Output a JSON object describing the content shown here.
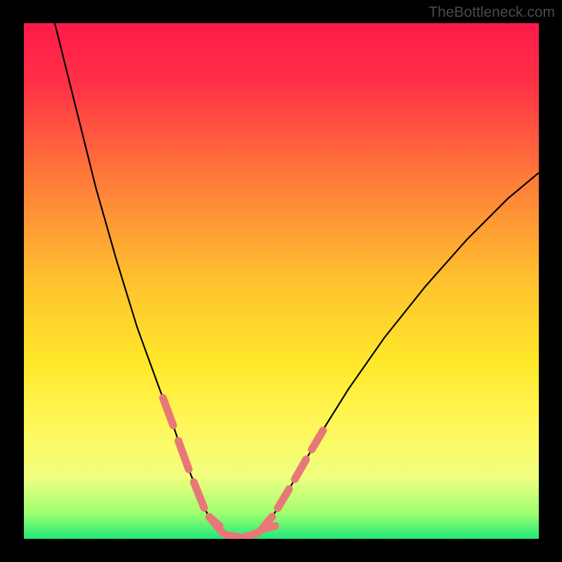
{
  "watermark": "TheBottleneck.com",
  "chart_data": {
    "type": "line",
    "title": "",
    "xlabel": "",
    "ylabel": "",
    "x_range": [
      0,
      100
    ],
    "y_range": [
      0,
      100
    ],
    "background_gradient": {
      "stops": [
        {
          "offset": 0,
          "color": "#ff1a4a"
        },
        {
          "offset": 0.12,
          "color": "#ff3246"
        },
        {
          "offset": 0.3,
          "color": "#ff7a3a"
        },
        {
          "offset": 0.5,
          "color": "#ffc22e"
        },
        {
          "offset": 0.66,
          "color": "#ffe82a"
        },
        {
          "offset": 0.78,
          "color": "#fff85a"
        },
        {
          "offset": 0.88,
          "color": "#f0ff80"
        },
        {
          "offset": 0.95,
          "color": "#a0ff70"
        },
        {
          "offset": 1.0,
          "color": "#20e878"
        }
      ]
    },
    "curve": {
      "description": "V-shaped bottleneck curve",
      "points": [
        {
          "x": 6,
          "y": 100
        },
        {
          "x": 10,
          "y": 84
        },
        {
          "x": 14,
          "y": 68
        },
        {
          "x": 18,
          "y": 54
        },
        {
          "x": 22,
          "y": 41
        },
        {
          "x": 26,
          "y": 30
        },
        {
          "x": 29,
          "y": 22
        },
        {
          "x": 31,
          "y": 16
        },
        {
          "x": 33,
          "y": 11
        },
        {
          "x": 35,
          "y": 6
        },
        {
          "x": 37,
          "y": 2.5
        },
        {
          "x": 39,
          "y": 0.8
        },
        {
          "x": 41,
          "y": 0.3
        },
        {
          "x": 43,
          "y": 0.3
        },
        {
          "x": 45,
          "y": 0.8
        },
        {
          "x": 47,
          "y": 2.5
        },
        {
          "x": 50,
          "y": 7
        },
        {
          "x": 54,
          "y": 14
        },
        {
          "x": 58,
          "y": 21
        },
        {
          "x": 63,
          "y": 29
        },
        {
          "x": 70,
          "y": 39
        },
        {
          "x": 78,
          "y": 49
        },
        {
          "x": 86,
          "y": 58
        },
        {
          "x": 94,
          "y": 66
        },
        {
          "x": 100,
          "y": 71
        }
      ]
    },
    "highlight_segments": {
      "color": "#e87878",
      "description": "Dashed pink overlay segments near minimum",
      "left_branch_range": [
        27,
        37
      ],
      "right_branch_range": [
        46,
        58
      ],
      "bottom_range": [
        36,
        47
      ]
    }
  }
}
